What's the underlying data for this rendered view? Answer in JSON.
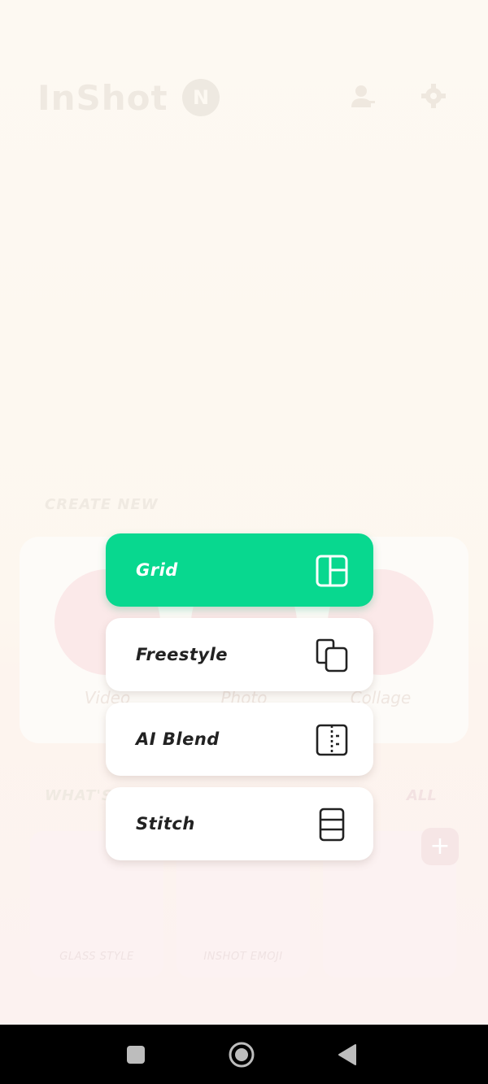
{
  "app": {
    "logo_text": "InShot",
    "new_badge": "N"
  },
  "header": {
    "icons": [
      "user-icon",
      "settings-gear-icon"
    ]
  },
  "create_new": {
    "title": "CREATE NEW",
    "items": [
      {
        "label": "Video",
        "icon": "video-icon"
      },
      {
        "label": "Photo",
        "icon": "photo-icon"
      },
      {
        "label": "Collage",
        "icon": "collage-icon"
      }
    ]
  },
  "whats_new": {
    "title": "WHAT'S NEW",
    "all_label": "ALL",
    "cards": [
      {
        "label": "GLASS STYLE"
      },
      {
        "label": "INSHOT EMOJI"
      },
      {
        "label": ""
      }
    ]
  },
  "collage_menu": {
    "items": [
      {
        "label": "Grid",
        "icon": "grid-layout-icon",
        "selected": true
      },
      {
        "label": "Freestyle",
        "icon": "freestyle-pages-icon",
        "selected": false
      },
      {
        "label": "AI Blend",
        "icon": "ai-blend-split-icon",
        "selected": false
      },
      {
        "label": "Stitch",
        "icon": "stitch-stack-icon",
        "selected": false
      }
    ]
  },
  "colors": {
    "accent": "#08d88f",
    "background": "#fdf8f1",
    "menu_text": "#222222",
    "navbar": "#000000"
  },
  "navbar": {
    "buttons": [
      "recents-square-icon",
      "home-circle-icon",
      "back-triangle-icon"
    ]
  }
}
